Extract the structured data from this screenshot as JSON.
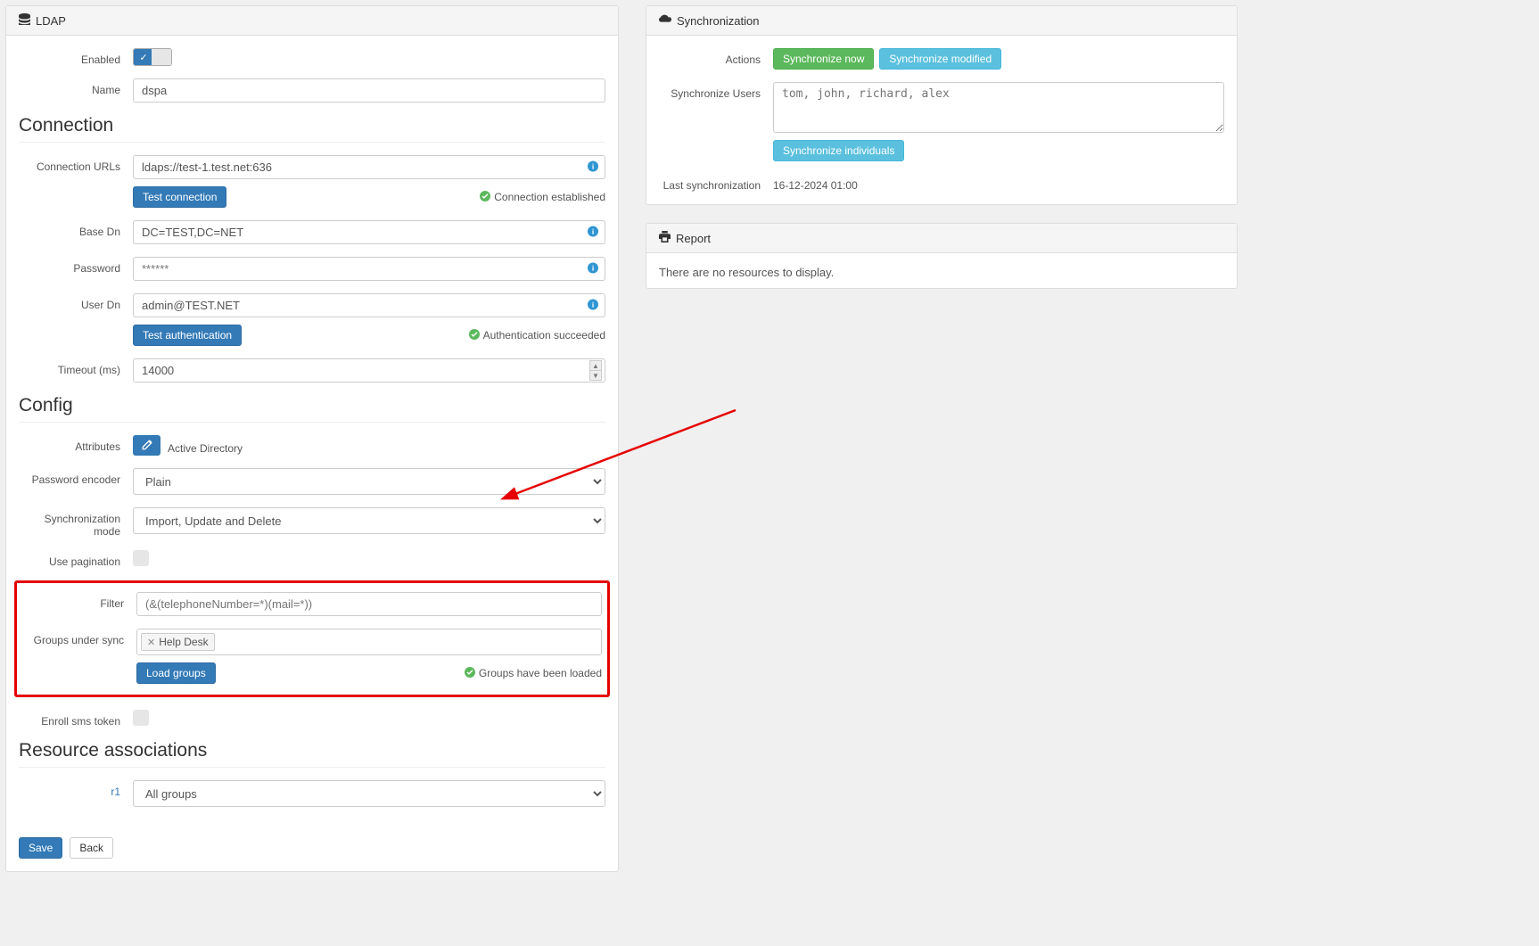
{
  "ldap": {
    "panel_title": "LDAP",
    "enabled_label": "Enabled",
    "name_label": "Name",
    "name_value": "dspa"
  },
  "connection": {
    "section_title": "Connection",
    "urls_label": "Connection URLs",
    "urls_value": "ldaps://test-1.test.net:636",
    "test_connection_btn": "Test connection",
    "connection_status": "Connection established",
    "base_dn_label": "Base Dn",
    "base_dn_value": "DC=TEST,DC=NET",
    "password_label": "Password",
    "password_placeholder": "******",
    "user_dn_label": "User Dn",
    "user_dn_value": "admin@TEST.NET",
    "test_auth_btn": "Test authentication",
    "auth_status": "Authentication succeeded",
    "timeout_label": "Timeout (ms)",
    "timeout_value": "14000"
  },
  "config": {
    "section_title": "Config",
    "attributes_label": "Attributes",
    "attributes_text": "Active Directory",
    "pwd_encoder_label": "Password encoder",
    "pwd_encoder_value": "Plain",
    "sync_mode_label": "Synchronization mode",
    "sync_mode_value": "Import, Update and Delete",
    "pagination_label": "Use pagination",
    "filter_label": "Filter",
    "filter_placeholder": "(&(telephoneNumber=*)(mail=*))",
    "groups_label": "Groups under sync",
    "groups_tag": "Help Desk",
    "load_groups_btn": "Load groups",
    "groups_status": "Groups have been loaded",
    "enroll_sms_label": "Enroll sms token"
  },
  "resource_assoc": {
    "section_title": "Resource associations",
    "r1_label": "r1",
    "r1_value": "All groups"
  },
  "footer": {
    "save": "Save",
    "back": "Back"
  },
  "sync": {
    "panel_title": "Synchronization",
    "actions_label": "Actions",
    "sync_now_btn": "Synchronize now",
    "sync_modified_btn": "Synchronize modified",
    "sync_users_label": "Synchronize Users",
    "sync_users_placeholder": "tom, john, richard, alex",
    "sync_individuals_btn": "Synchronize individuals",
    "last_sync_label": "Last synchronization",
    "last_sync_value": "16-12-2024 01:00"
  },
  "report": {
    "panel_title": "Report",
    "empty_text": "There are no resources to display."
  }
}
